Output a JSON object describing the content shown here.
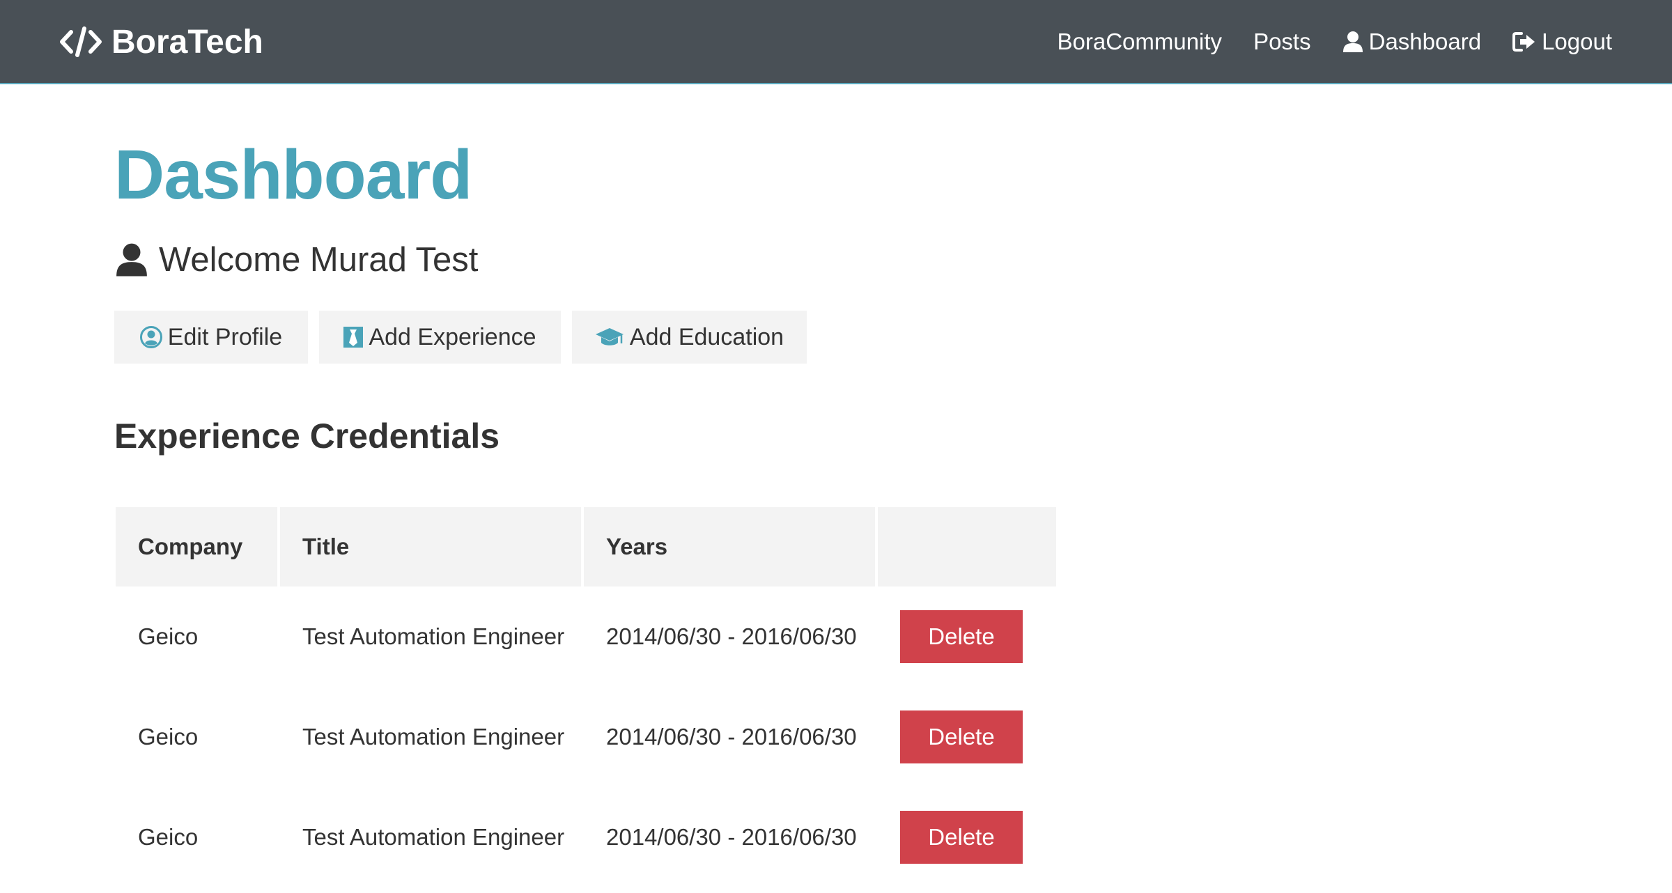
{
  "navbar": {
    "brand": "BoraTech",
    "brand_icon": "code-icon",
    "links": [
      {
        "label": "BoraCommunity"
      },
      {
        "label": "Posts"
      },
      {
        "label": "Dashboard",
        "icon": "user-icon"
      },
      {
        "label": "Logout",
        "icon": "sign-out-icon"
      }
    ]
  },
  "page": {
    "title": "Dashboard",
    "welcome": "Welcome Murad Test",
    "buttons": {
      "edit_profile": "Edit Profile",
      "add_experience": "Add Experience",
      "add_education": "Add Education"
    }
  },
  "experience": {
    "title": "Experience Credentials",
    "columns": [
      "Company",
      "Title",
      "Years",
      ""
    ],
    "rows": [
      {
        "company": "Geico",
        "title": "Test Automation Engineer",
        "years": "2014/06/30 - 2016/06/30",
        "action": "Delete"
      },
      {
        "company": "Geico",
        "title": "Test Automation Engineer",
        "years": "2014/06/30 - 2016/06/30",
        "action": "Delete"
      },
      {
        "company": "Geico",
        "title": "Test Automation Engineer",
        "years": "2014/06/30 - 2016/06/30",
        "action": "Delete"
      }
    ]
  },
  "colors": {
    "navbar_bg": "#495056",
    "accent": "#4aa3b8",
    "danger": "#d0424b",
    "light_button": "#f3f3f3"
  }
}
